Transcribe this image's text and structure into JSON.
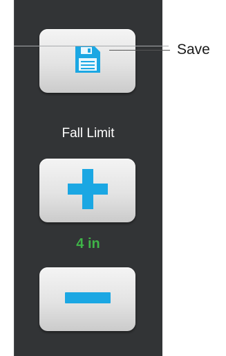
{
  "callout": {
    "save_label": "Save"
  },
  "fall_limit": {
    "label": "Fall Limit",
    "value": "4 in",
    "value_color": "#3fb548"
  },
  "colors": {
    "panel": "#323436",
    "icon_blue": "#1ba7e3",
    "button_face": "#e3e3e3"
  },
  "icons": {
    "save": "floppy-disk-icon",
    "increase": "plus-icon",
    "decrease": "minus-icon"
  }
}
